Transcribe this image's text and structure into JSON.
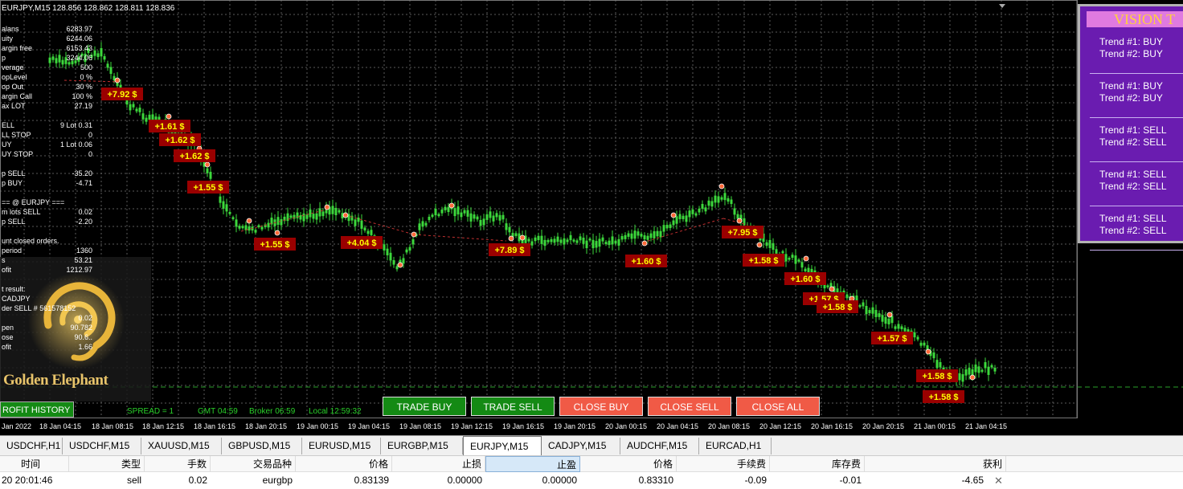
{
  "header": "EURJPY,M15  128.856 128.862 128.811 128.836",
  "info": [
    [
      "alans",
      "6283.97"
    ],
    [
      "uity",
      "6244.06"
    ],
    [
      "argin free",
      "6153.43"
    ],
    [
      "p",
      "3244.06"
    ],
    [
      "verage",
      "500"
    ],
    [
      "opLevel",
      "0 %"
    ],
    [
      "op Out",
      "30 %"
    ],
    [
      "argin Call",
      "100 %"
    ],
    [
      "ax LOT",
      "27.19"
    ],
    [
      "",
      ""
    ],
    [
      "ELL",
      "9   Lot  0.31"
    ],
    [
      "LL STOP",
      "0"
    ],
    [
      "UY",
      "1   Lot  0.06"
    ],
    [
      "UY STOP",
      "0"
    ],
    [
      "",
      ""
    ],
    [
      "p      SELL",
      "-35.20"
    ],
    [
      "p      BUY",
      "-4.71"
    ],
    [
      "",
      ""
    ],
    [
      "== @ EURJPY ===",
      ""
    ],
    [
      "m lots SELL",
      "0.02"
    ],
    [
      "p      SELL",
      "-2.20"
    ],
    [
      "",
      ""
    ],
    [
      "unt closed orders.",
      ""
    ],
    [
      "period",
      "1360"
    ],
    [
      "s",
      "53.21"
    ],
    [
      "ofit",
      "1212.97"
    ],
    [
      "",
      ""
    ],
    [
      "t result:",
      ""
    ],
    [
      "       CADJPY",
      ""
    ],
    [
      "der  SELL  # 561578152",
      ""
    ],
    [
      "",
      "0.02"
    ],
    [
      "pen",
      "90.782"
    ],
    [
      "ose",
      "90.6.."
    ],
    [
      "ofit",
      "1.66"
    ]
  ],
  "logo_text": "Golden Elephant",
  "profit_history_button": "ROFIT HISTORY",
  "status": {
    "spread": "SPREAD = 1",
    "gmt": "GMT 04:59",
    "broker": "Broker 06:59",
    "local": "Local 12:59:32"
  },
  "buttons": {
    "trade_buy": "TRADE BUY",
    "trade_sell": "TRADE SELL",
    "close_buy": "CLOSE BUY",
    "close_sell": "CLOSE SELL",
    "close_all": "CLOSE ALL"
  },
  "xticks": [
    "Jan 2022",
    "18 Jan 04:15",
    "18 Jan 08:15",
    "18 Jan 12:15",
    "18 Jan 16:15",
    "18 Jan 20:15",
    "19 Jan 00:15",
    "19 Jan 04:15",
    "19 Jan 08:15",
    "19 Jan 12:15",
    "19 Jan 16:15",
    "19 Jan 20:15",
    "20 Jan 00:15",
    "20 Jan 04:15",
    "20 Jan 08:15",
    "20 Jan 12:15",
    "20 Jan 16:15",
    "20 Jan 20:15",
    "21 Jan 00:15",
    "21 Jan 04:15"
  ],
  "profit_labels": [
    "+7.92 $",
    "+1.61 $",
    "+1.62 $",
    "+1.62 $",
    "+1.55 $",
    "+1.55 $",
    "+4.04 $",
    "+7.89 $",
    "+1.60 $",
    "+7.95 $",
    "+1.58 $",
    "+1.60 $",
    "+1.57 $",
    "+1.58 $",
    "+1.57 $",
    "+1.58 $",
    "+1.58 $"
  ],
  "vision_panel": {
    "title": "VISION T",
    "blocks": [
      [
        "Trend #1: BUY",
        "Trend #2: BUY"
      ],
      [
        "Trend #1: BUY",
        "Trend #2: BUY"
      ],
      [
        "Trend #1: SELL",
        "Trend #2: SELL"
      ],
      [
        "Trend #1: SELL",
        "Trend #2: SELL"
      ],
      [
        "Trend #1: SELL",
        "Trend #2: SELL"
      ]
    ]
  },
  "tabs": [
    "USDCHF,H1",
    "USDCHF,M15",
    "XAUUSD,M15",
    "GBPUSD,M15",
    "EURUSD,M15",
    "EURGBP,M15",
    "EURJPY,M15",
    "CADJPY,M15",
    "AUDCHF,M15",
    "EURCAD,H1"
  ],
  "active_tab": "EURJPY,M15",
  "table": {
    "headers": [
      "时间",
      "类型",
      "手数",
      "交易品种",
      "价格",
      "止损",
      "止盈",
      "价格",
      "手续费",
      "库存费",
      "获利"
    ],
    "row": [
      "20 20:01:46",
      "sell",
      "0.02",
      "eurgbp",
      "0.83139",
      "0.00000",
      "0.00000",
      "0.83310",
      "-0.09",
      "-0.01",
      "-4.65"
    ]
  },
  "colors": {
    "candle": "#3cd83c",
    "grid": "#5a5a5a",
    "label_bg": "#9a0000",
    "label_text": "#ffff00",
    "panel_purple": "#6a1cb0"
  }
}
